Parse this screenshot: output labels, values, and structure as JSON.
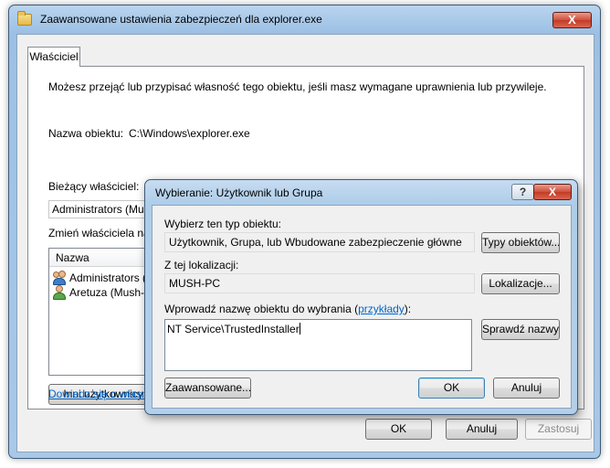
{
  "main_window": {
    "title": "Zaawansowane ustawienia zabezpieczeń dla explorer.exe",
    "close_glyph": "X",
    "tab_label": "Właściciel",
    "description": "Możesz przejąć lub przypisać własność tego obiektu, jeśli masz wymagane uprawnienia lub przywileje.",
    "object_name_label": "Nazwa obiektu:",
    "object_name_value": "C:\\Windows\\explorer.exe",
    "current_owner_label": "Bieżący właściciel:",
    "current_owner_value": "Administrators (Mush-PC\\Administrators)",
    "change_owner_label": "Zmień właściciela na:",
    "list_header": "Nazwa",
    "list_items": [
      {
        "label": "Administrators (Mush",
        "icon": "group-icon"
      },
      {
        "label": "Aretuza (Mush-PC\\A",
        "icon": "user-icon"
      }
    ],
    "other_users_button": "Inni użytkownicy i gr",
    "learn_more_link": "Dowiedz się o własności",
    "ok_button": "OK",
    "cancel_button": "Anuluj",
    "apply_button": "Zastosuj"
  },
  "dialog": {
    "title": "Wybieranie: Użytkownik lub Grupa",
    "help_glyph": "?",
    "close_glyph": "X",
    "object_type_label": "Wybierz ten typ obiektu:",
    "object_type_value": "Użytkownik, Grupa, lub Wbudowane zabezpieczenie główne",
    "object_types_button": "Typy obiektów...",
    "location_label": "Z tej lokalizacji:",
    "location_value": "MUSH-PC",
    "locations_button": "Lokalizacje...",
    "enter_name_label": "Wprowadź nazwę obiektu do wybrania (",
    "examples_link": "przykłady",
    "enter_name_suffix": "):",
    "input_value": "NT Service\\TrustedInstaller",
    "check_names_button": "Sprawdź nazwy",
    "advanced_button": "Zaawansowane...",
    "ok_button": "OK",
    "cancel_button": "Anuluj"
  }
}
